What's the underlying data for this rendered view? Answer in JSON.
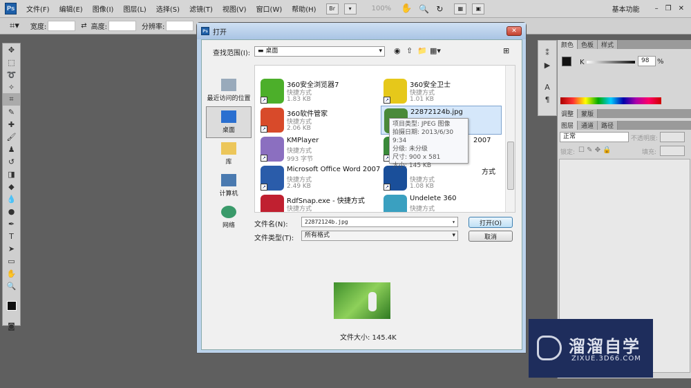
{
  "app": {
    "logo": "Ps",
    "menu": [
      "文件(F)",
      "编辑(E)",
      "图像(I)",
      "图层(L)",
      "选择(S)",
      "滤镜(T)",
      "视图(V)",
      "窗口(W)",
      "帮助(H)"
    ],
    "zoom": "100%",
    "workspace": "基本功能"
  },
  "options": {
    "width_label": "宽度:",
    "height_label": "高度:",
    "resolution_label": "分辨率:"
  },
  "dialog": {
    "title": "打开",
    "lookin_label": "查找范围(I):",
    "lookin_value": "桌面",
    "places": [
      "最近访问的位置",
      "桌面",
      "库",
      "计算机",
      "网络"
    ],
    "files": [
      {
        "name": "360安全浏览器7",
        "type": "快捷方式",
        "size": "1.83 KB",
        "color": "#4caf2a"
      },
      {
        "name": "360安全卫士",
        "type": "快捷方式",
        "size": "1.01 KB",
        "color": "#e6c81a"
      },
      {
        "name": "360软件管家",
        "type": "快捷方式",
        "size": "2.06 KB",
        "color": "#d84a2a"
      },
      {
        "name": "22872124b.jpg",
        "type": "JPEG 图像",
        "size": "",
        "color": "#4a8a3a"
      },
      {
        "name": "KMPlayer",
        "type": "快捷方式",
        "size": "993 字节",
        "color": "#8b6fc0"
      },
      {
        "name": "2007",
        "type": "",
        "size": "",
        "color": "#3a8a3a"
      },
      {
        "name": "Microsoft Office Word 2007",
        "type": "快捷方式",
        "size": "2.49 KB",
        "color": "#2a5caa"
      },
      {
        "name": "方式",
        "type": "快捷方式",
        "size": "1.08 KB",
        "color": "#1a4f9a"
      },
      {
        "name": "RdfSnap.exe - 快捷方式",
        "type": "快捷方式",
        "size": "920 字节",
        "color": "#c02030"
      },
      {
        "name": "Undelete 360",
        "type": "快捷方式",
        "size": "1.14 KB",
        "color": "#3aa0c0"
      }
    ],
    "tooltip": [
      "项目类型: JPEG 图像",
      "拍摄日期: 2013/6/30 9:34",
      "分级: 未分级",
      "尺寸: 900 x 581",
      "大小: 145 KB"
    ],
    "filename_label": "文件名(N):",
    "filename_value": "22872124b.jpg",
    "filetype_label": "文件类型(T):",
    "filetype_value": "所有格式",
    "open_button": "打开(O)",
    "cancel_button": "取消",
    "filesize": "文件大小: 145.4K"
  },
  "panels": {
    "color_tabs": [
      "颜色",
      "色板",
      "样式"
    ],
    "k_label": "K",
    "k_value": "98",
    "percent": "%",
    "adjust_tabs": [
      "调整",
      "蒙版"
    ],
    "layer_tabs": [
      "图层",
      "通道",
      "路径"
    ],
    "blend_mode": "正常",
    "opacity_label": "不透明度:",
    "lock_label": "锁定:",
    "fill_label": "填充:"
  },
  "watermark": {
    "name": "溜溜自学",
    "url": "ZIXUE.3D66.COM"
  }
}
